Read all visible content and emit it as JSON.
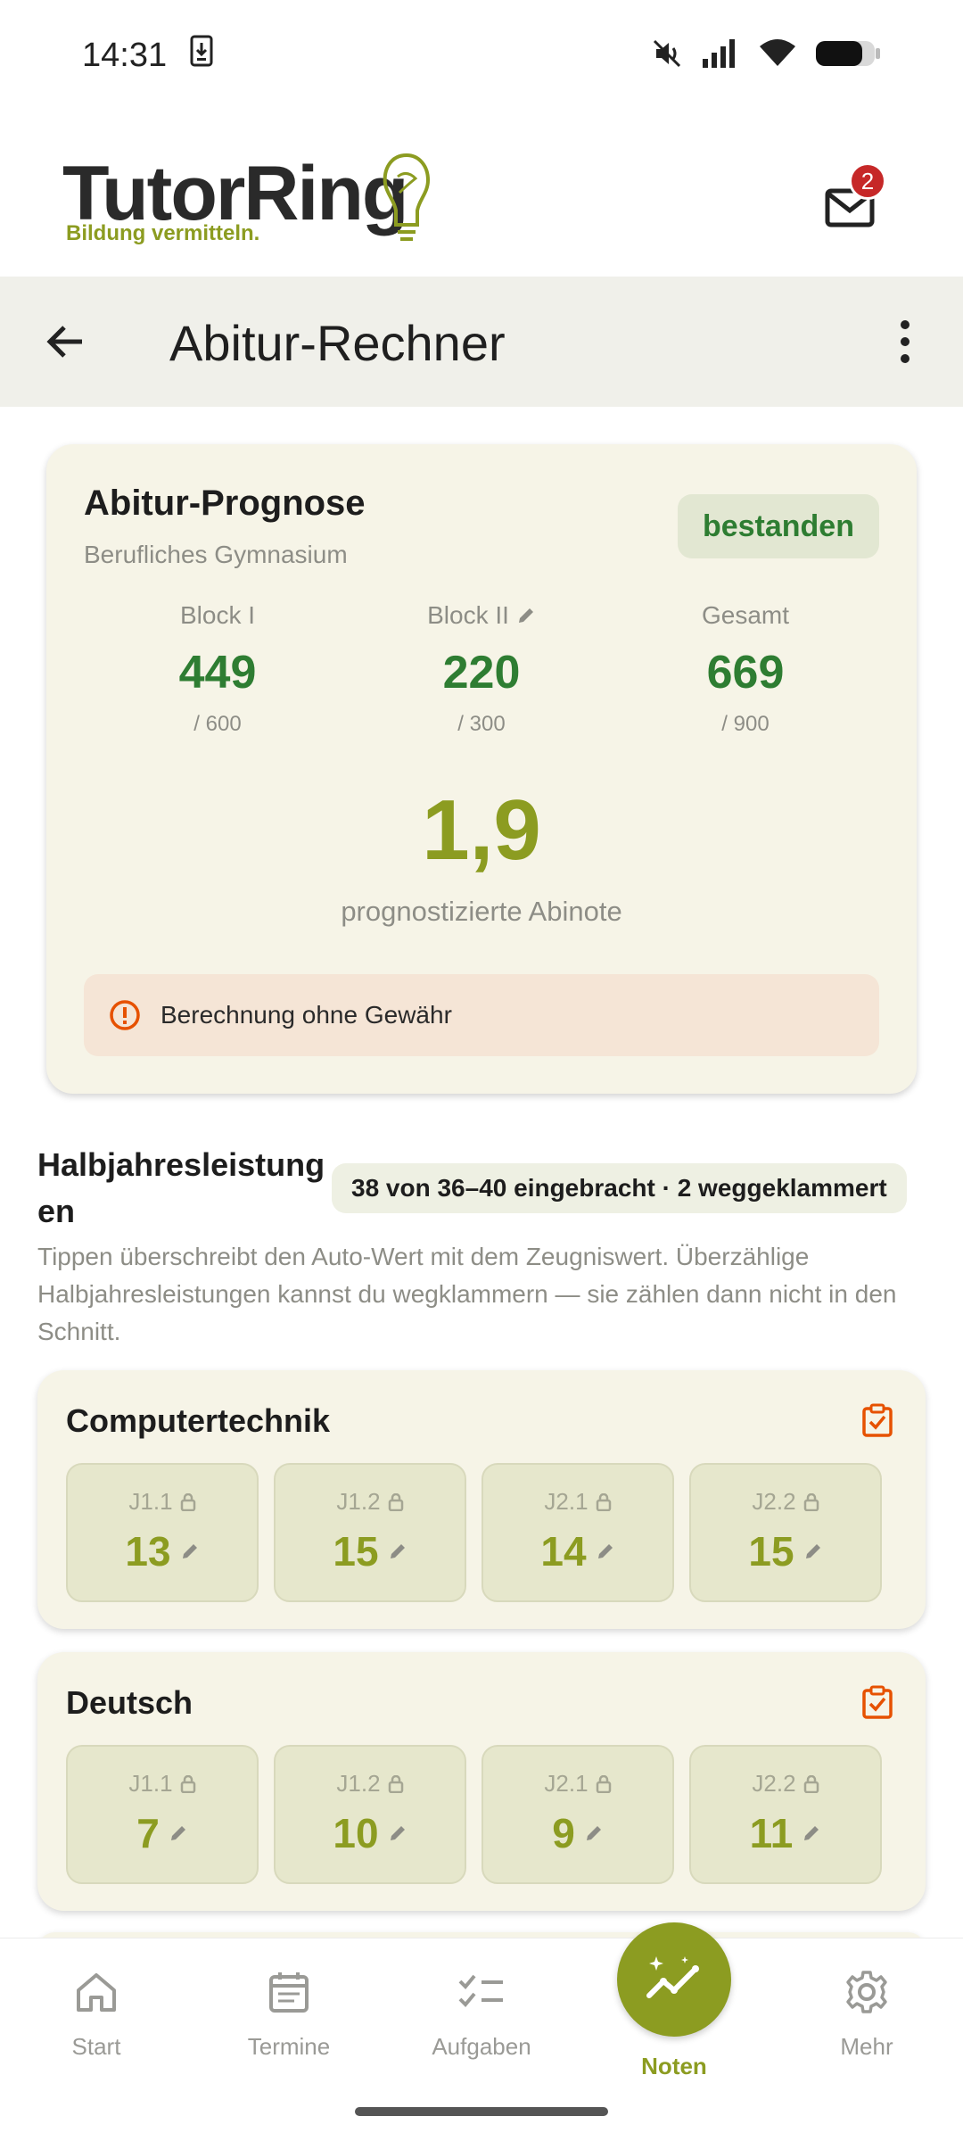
{
  "status_bar": {
    "time": "14:31"
  },
  "brand": {
    "name": "TutorRing",
    "tagline": "Bildung vermitteln.",
    "mail_badge_count": "2",
    "colors": {
      "accent": "#8c9c21",
      "green": "#2e7d32",
      "badge": "#c62828"
    }
  },
  "app_bar": {
    "title": "Abitur-Rechner"
  },
  "prognosis": {
    "title": "Abitur-Prognose",
    "subtitle": "Berufliches Gymnasium",
    "status": "bestanden",
    "blocks": [
      {
        "label": "Block I",
        "value": "449",
        "max": "/ 600"
      },
      {
        "label": "Block II",
        "value": "220",
        "max": "/ 300"
      },
      {
        "label": "Gesamt",
        "value": "669",
        "max": "/ 900"
      }
    ],
    "grade": "1,9",
    "grade_caption": "prognostizierte Abinote",
    "disclaimer": "Berechnung ohne Gewähr"
  },
  "section": {
    "title": "Halbjahresleistungen",
    "title_line1": "Halbjahresleistung",
    "title_line2": "en",
    "chip": "38 von 36–40 eingebracht · 2 weggeklammert",
    "description": "Tippen überschreibt den Auto-Wert mit dem Zeugniswert. Überzählige Halbjahresleistungen kannst du wegklammern — sie zählen dann nicht in den Schnitt."
  },
  "subjects": [
    {
      "name": "Computertechnik",
      "grades": [
        {
          "term": "J1.1",
          "value": "13"
        },
        {
          "term": "J1.2",
          "value": "15"
        },
        {
          "term": "J2.1",
          "value": "14"
        },
        {
          "term": "J2.2",
          "value": "15"
        }
      ]
    },
    {
      "name": "Deutsch",
      "grades": [
        {
          "term": "J1.1",
          "value": "7"
        },
        {
          "term": "J1.2",
          "value": "10"
        },
        {
          "term": "J2.1",
          "value": "9"
        },
        {
          "term": "J2.2",
          "value": "11"
        }
      ]
    }
  ],
  "nav": {
    "items": [
      {
        "label": "Start",
        "icon": "home-icon"
      },
      {
        "label": "Termine",
        "icon": "calendar-icon"
      },
      {
        "label": "Aufgaben",
        "icon": "checklist-icon"
      },
      {
        "label": "Noten",
        "icon": "sparkle-chart-icon",
        "active": true
      },
      {
        "label": "Mehr",
        "icon": "gear-icon"
      }
    ]
  }
}
